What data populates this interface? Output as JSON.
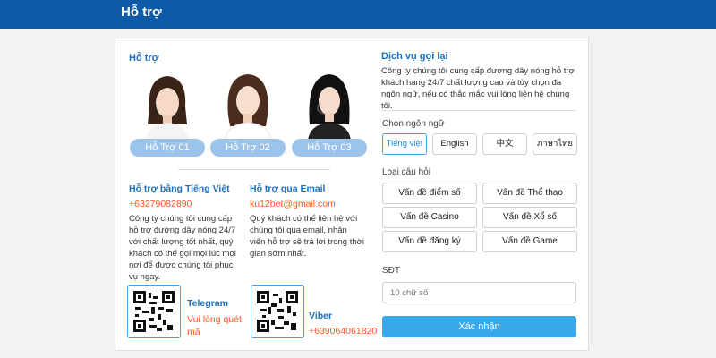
{
  "header": {
    "title": "Hỗ trợ"
  },
  "support": {
    "heading": "Hỗ trợ",
    "agents": [
      {
        "label": "Hỗ Trợ 01"
      },
      {
        "label": "Hỗ Trợ 02"
      },
      {
        "label": "Hỗ Trợ 03"
      }
    ]
  },
  "vietnamese": {
    "heading": "Hỗ trợ bằng Tiếng Việt",
    "phone": "+63279082890",
    "description": "Công ty chúng tôi cung cấp hỗ trợ đường dây nóng 24/7 với chất lượng tốt nhất, quý khách có thể gọi mọi lúc mọi nơi để được chúng tôi phục vụ ngay."
  },
  "email": {
    "heading": "Hỗ trợ qua Email",
    "address": "ku12bet@gmail.com",
    "description": "Quý khách có thể liên hệ với chúng tôi qua email, nhân viên hỗ trợ sẽ trả lời trong thời gian sớm nhất."
  },
  "telegram": {
    "title": "Telegram",
    "subtitle": "Vui lòng quét mã"
  },
  "viber": {
    "title": "Viber",
    "subtitle": "+639064061820"
  },
  "callback": {
    "heading": "Dịch vụ gọi lại",
    "description": "Công ty chúng tôi cung cấp đường dây nóng hỗ trợ khách hàng 24/7 chất lượng cao và tùy chọn đa ngôn ngữ, nếu có thắc mắc vui lòng liên hệ chúng tôi.",
    "language_label": "Chọn ngôn ngữ",
    "languages": [
      "Tiếng việt",
      "English",
      "中文",
      "ภาษาไทย"
    ],
    "question_label": "Loại câu hỏi",
    "questions": [
      "Vấn đề điểm số",
      "Vấn đề Thể thao",
      "Vấn đề Casino",
      "Vấn đề Xổ số",
      "Vấn đề đăng ký",
      "Vấn đề Game"
    ],
    "phone_label": "SĐT",
    "phone_placeholder": "10 chữ số",
    "submit_label": "Xác nhận"
  },
  "colors": {
    "header": "#0e5aa7",
    "accent": "#1a6fc4",
    "contact": "#ff5722",
    "submit": "#39a7ec",
    "pill": "#9cc4ea"
  }
}
